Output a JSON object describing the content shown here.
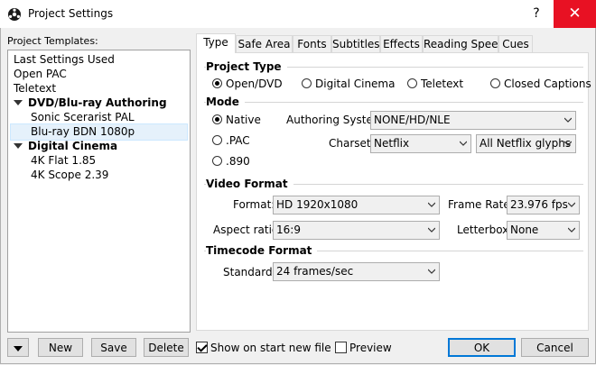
{
  "window": {
    "title": "Project Settings",
    "help": "?",
    "close": "✕"
  },
  "templates": {
    "label": "Project Templates:",
    "items": [
      {
        "text": "Last Settings Used",
        "kind": "item"
      },
      {
        "text": "Open PAC",
        "kind": "item"
      },
      {
        "text": "Teletext",
        "kind": "item"
      },
      {
        "text": "DVD/Blu-ray Authoring",
        "kind": "header"
      },
      {
        "text": "Sonic Scerarist PAL",
        "kind": "sub"
      },
      {
        "text": "Blu-ray BDN 1080p",
        "kind": "sub-selected"
      },
      {
        "text": "Digital Cinema",
        "kind": "header"
      },
      {
        "text": "4K Flat 1.85",
        "kind": "sub"
      },
      {
        "text": "4K Scope 2.39",
        "kind": "sub"
      }
    ]
  },
  "bottom": {
    "new": "New",
    "save": "Save",
    "delete": "Delete",
    "show_on_start": "Show on start new file",
    "show_on_start_checked": true,
    "preview": "Preview",
    "preview_checked": false,
    "ok": "OK",
    "cancel": "Cancel"
  },
  "tabs": [
    "Type",
    "Safe Area",
    "Fonts",
    "Subtitles",
    "Effects",
    "Reading Speed",
    "Cues"
  ],
  "active_tab": "Type",
  "project_type": {
    "title": "Project Type",
    "options": [
      "Open/DVD",
      "Digital Cinema",
      "Teletext",
      "Closed Captions"
    ],
    "selected": "Open/DVD"
  },
  "mode": {
    "title": "Mode",
    "options": [
      "Native",
      ".PAC",
      ".890"
    ],
    "selected": "Native",
    "authoring_system_label": "Authoring System:",
    "authoring_system_value": "NONE/HD/NLE",
    "charset_label": "Charset:",
    "charset_value": "Netflix",
    "glyphs_value": "All Netflix glyphs"
  },
  "video_format": {
    "title": "Video Format",
    "format_label": "Format:",
    "format_value": "HD 1920x1080",
    "frame_rate_label": "Frame Rate:",
    "frame_rate_value": "23.976 fps",
    "aspect_label": "Aspect ratio:",
    "aspect_value": "16:9",
    "letterbox_label": "Letterbox:",
    "letterbox_value": "None"
  },
  "timecode_format": {
    "title": "Timecode Format",
    "standard_label": "Standard:",
    "standard_value": "24 frames/sec"
  }
}
